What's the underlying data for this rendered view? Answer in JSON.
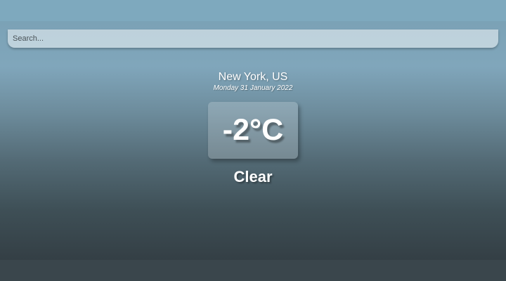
{
  "search": {
    "placeholder": "Search...",
    "value": ""
  },
  "weather": {
    "location": "New York, US",
    "date": "Monday 31 January 2022",
    "temperature": "-2°C",
    "condition": "Clear"
  },
  "colors": {
    "text": "#ffffff",
    "background_top": "#7ea7bc",
    "background_bottom": "#343f45"
  }
}
